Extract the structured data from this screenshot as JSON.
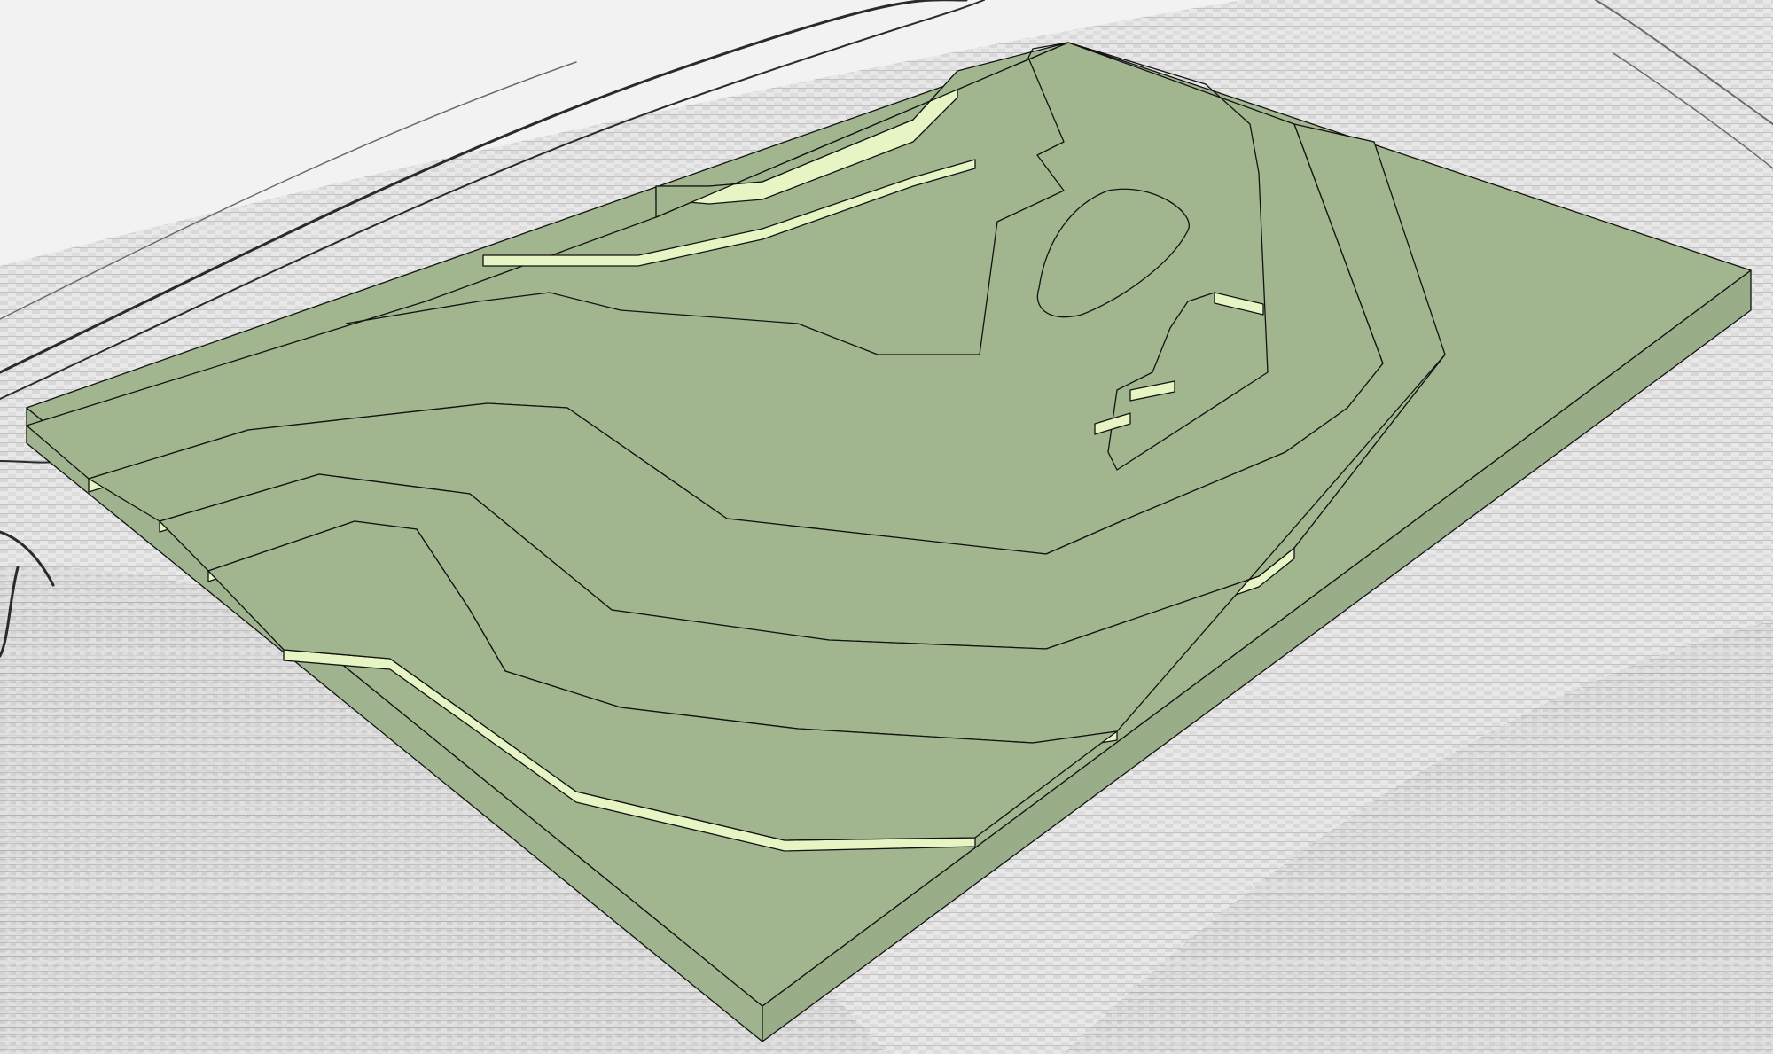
{
  "window": {
    "title": ""
  },
  "scene": {
    "description_kind": "3d-viewport",
    "colors": {
      "background": "#f2f2f2",
      "ground_light": "#eeeeee",
      "ground_dark": "#bdbdbd",
      "ground_line": "#6a6a6a",
      "ground_line_dark": "#2a2a2a",
      "terrain_top": "#a1b58f",
      "terrain_side": "#9fb38e",
      "terrain_edge": "#121212",
      "step_face": "#e6f5c3",
      "step_face_shadow": "#cfe4aa"
    },
    "model": {
      "type": "stepped-contour-terrain",
      "layers": 5
    }
  }
}
